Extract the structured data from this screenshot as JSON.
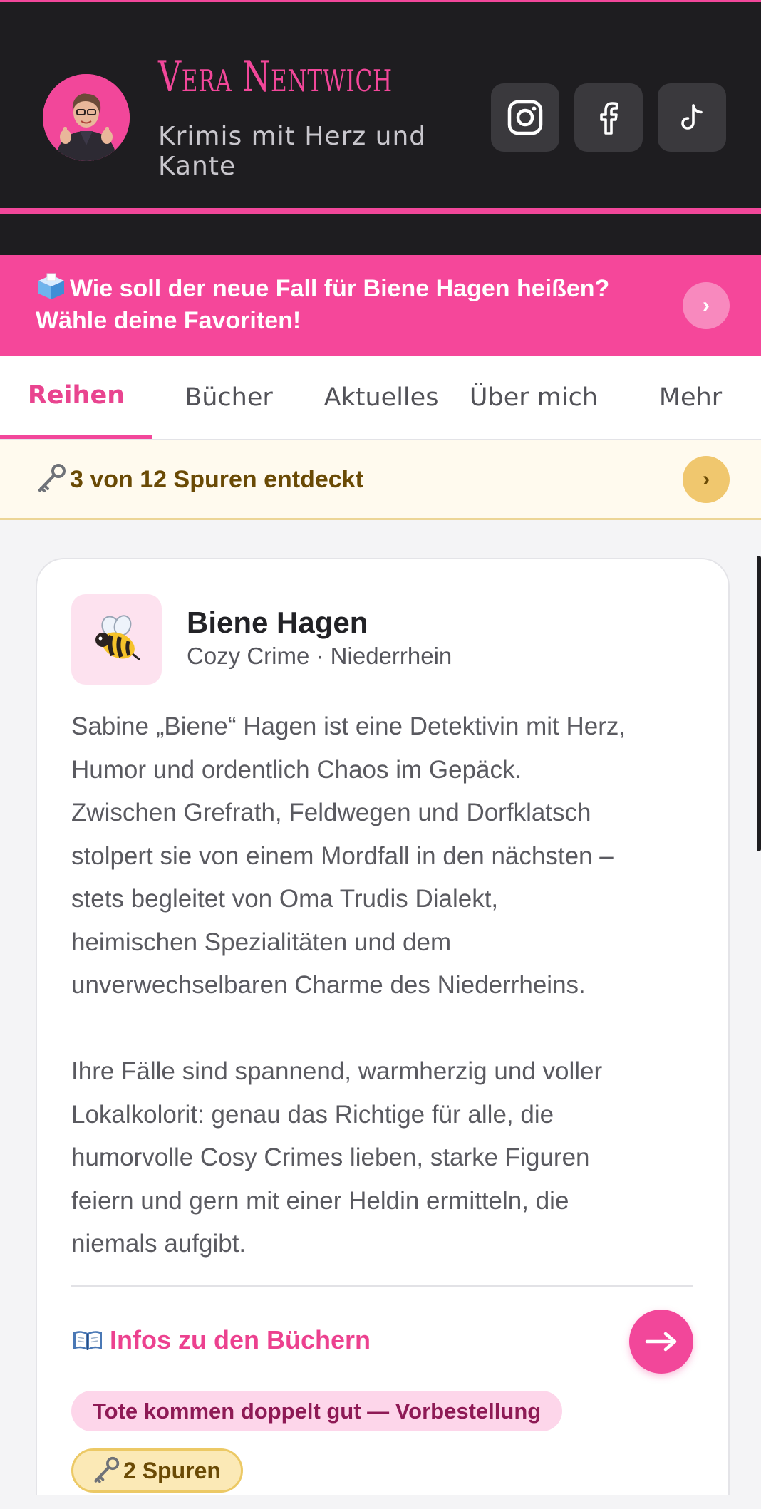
{
  "header": {
    "name": "Vera Nentwich",
    "tagline": "Krimis mit Herz und Kante",
    "social": [
      "instagram-icon",
      "facebook-icon",
      "tiktok-icon"
    ]
  },
  "promo": {
    "icon": "ballot-box-icon",
    "text": "Wie soll der neue Fall für Biene Hagen heißen? Wähle deine Favoriten!",
    "chevron": "›"
  },
  "tabs": [
    {
      "label": "Reihen",
      "active": true
    },
    {
      "label": "Bücher",
      "active": false
    },
    {
      "label": "Aktuelles",
      "active": false
    },
    {
      "label": "Über mich",
      "active": false
    },
    {
      "label": "Mehr",
      "active": false
    }
  ],
  "progress": {
    "icon": "key-icon",
    "text": "3 von 12 Spuren entdeckt",
    "chevron": "›"
  },
  "series": {
    "icon": "bee-icon",
    "title": "Biene Hagen",
    "subtitle": "Cozy Crime · Niederrhein",
    "description": "Sabine „Biene“ Hagen ist eine Detektivin mit Herz,\nHumor und ordentlich Chaos im Gepäck.\nZwischen Grefrath, Feldwegen und Dorfklatsch\nstolpert sie von einem Mordfall in den nächsten –\nstets begleitet von Oma Trudis Dialekt,\nheimischen Spezialitäten und dem\nunverwechselbaren Charme des Niederrheins.\n\nIhre Fälle sind spannend, warmherzig und voller\nLokalkolorit: genau das Richtige für alle, die\nhumorvolle Cosy Crimes lieben, starke Figuren\nfeiern und gern mit einer Heldin ermitteln, die\nniemals aufgibt.",
    "books_link": "Infos zu den Büchern",
    "preorder": "Tote kommen doppelt gut — Vorbestellung",
    "clues": "2 Spuren"
  },
  "colors": {
    "brand_pink": "#f2479a",
    "header_dark": "#1e1d20",
    "gold": "#f0c76e"
  }
}
